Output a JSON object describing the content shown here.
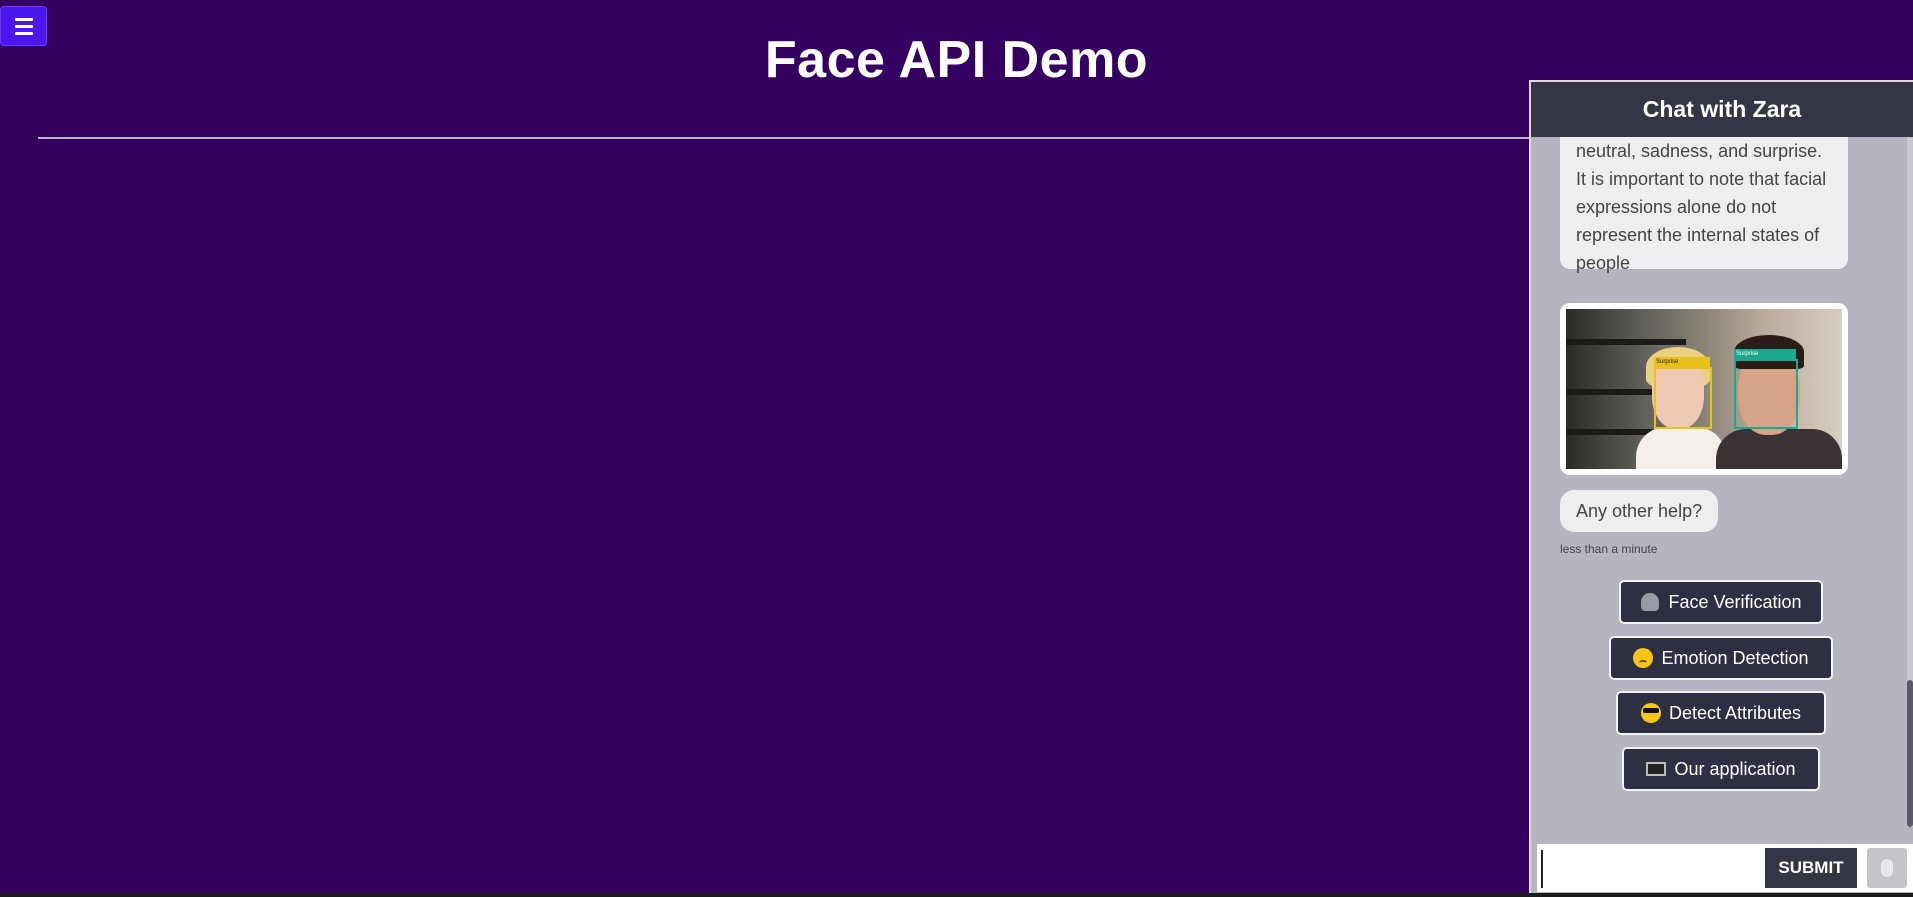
{
  "header": {
    "title": "Face API Demo"
  },
  "chat": {
    "title": "Chat with Zara",
    "messages": {
      "expressions_text": "neutral, sadness, and surprise. It is important to note that facial expressions alone do not represent the internal states of people",
      "image_tags": {
        "child": "Surprise",
        "man": "Surprise"
      },
      "help": "Any other help?",
      "timestamp": "less than a minute"
    },
    "suggestions": [
      {
        "label": "Face Verification",
        "icon": "user-silhouette-icon"
      },
      {
        "label": "Emotion Detection",
        "icon": "worried-face-icon"
      },
      {
        "label": "Detect Attributes",
        "icon": "sunglasses-face-icon"
      },
      {
        "label": "Our application",
        "icon": "monitor-icon"
      }
    ],
    "input": {
      "value": "",
      "placeholder": ""
    },
    "submit_label": "SUBMIT"
  },
  "colors": {
    "page_background": "#340161",
    "menu_button": "#4d16ee",
    "chat_header": "#353645",
    "chat_background": "#b6b5bf",
    "suggestion_button": "#2f2f43",
    "tag_yellow": "#e8c21a",
    "tag_green": "#19a98f"
  }
}
